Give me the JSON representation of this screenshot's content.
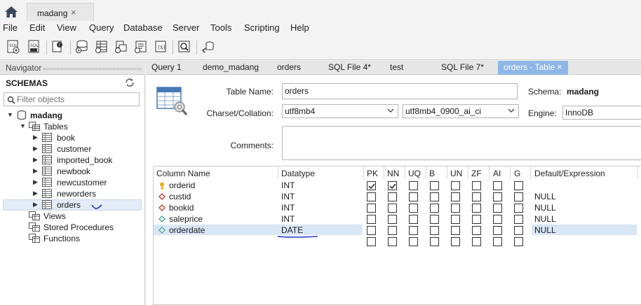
{
  "document_tab": {
    "title": "madang",
    "close": "×"
  },
  "menu": [
    "File",
    "Edit",
    "View",
    "Query",
    "Database",
    "Server",
    "Tools",
    "Scripting",
    "Help"
  ],
  "navigator": {
    "header": "Navigator",
    "schemas_label": "SCHEMAS",
    "filter_placeholder": "Filter objects",
    "schema_name": "madang",
    "tables_label": "Tables",
    "tables": [
      "book",
      "customer",
      "imported_book",
      "newbook",
      "newcustomer",
      "neworders",
      "orders"
    ],
    "views_label": "Views",
    "procedures_label": "Stored Procedures",
    "functions_label": "Functions"
  },
  "editor_tabs": [
    "Query 1",
    "demo_madang",
    "orders",
    "SQL File 4*",
    "test",
    "SQL File 7*"
  ],
  "active_tab": {
    "label": "orders - Table",
    "close": "×"
  },
  "form": {
    "table_name_label": "Table Name:",
    "table_name_value": "orders",
    "schema_label": "Schema:",
    "schema_value": "madang",
    "charset_label": "Charset/Collation:",
    "charset_value": "utf8mb4",
    "collation_value": "utf8mb4_0900_ai_ci",
    "engine_label": "Engine:",
    "engine_value": "InnoDB",
    "comments_label": "Comments:"
  },
  "grid": {
    "headers": [
      "Column Name",
      "Datatype",
      "PK",
      "NN",
      "UQ",
      "B",
      "UN",
      "ZF",
      "AI",
      "G",
      "Default/Expression"
    ],
    "rows": [
      {
        "name": "orderid",
        "type": "INT",
        "key": "primary",
        "pk": true,
        "nn": true,
        "default": ""
      },
      {
        "name": "custid",
        "type": "INT",
        "key": "foreign",
        "pk": false,
        "nn": false,
        "default": "NULL"
      },
      {
        "name": "bookid",
        "type": "INT",
        "key": "foreign",
        "pk": false,
        "nn": false,
        "default": "NULL"
      },
      {
        "name": "saleprice",
        "type": "INT",
        "key": "column",
        "pk": false,
        "nn": false,
        "default": "NULL"
      },
      {
        "name": "orderdate",
        "type": "DATE",
        "key": "column",
        "pk": false,
        "nn": false,
        "default": "NULL"
      }
    ]
  },
  "colors": {
    "accent": "#8eb6e6",
    "selected_row": "#d9e6f6",
    "annotation_pen": "#1f3fbf"
  }
}
